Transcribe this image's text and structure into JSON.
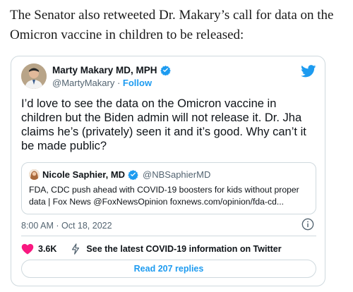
{
  "article": {
    "intro_text": "The Senator also retweeted Dr. Makary’s call for data on the Omicron vaccine in children to be released:"
  },
  "tweet": {
    "author_name": "Marty Makary MD, MPH",
    "author_handle": "@MartyMakary",
    "separator": "·",
    "follow_label": "Follow",
    "text": "I’d love to see the data on the Omicron vaccine in children but the Biden admin will not release it. Dr. Jha claims he’s (privately) seen it and it’s good. Why can’t it be made public?",
    "timestamp": "8:00 AM · Oct 18, 2022",
    "likes_count": "3.6K",
    "info_link_label": "See the latest COVID-19 information on Twitter",
    "read_replies_label": "Read 207 replies",
    "icons": {
      "brand": "twitter-bird-icon",
      "verified": "verified-badge-icon",
      "info": "info-icon",
      "like": "heart-icon",
      "info_link": "lightning-bolt-icon"
    }
  },
  "quote": {
    "author_name": "Nicole Saphier, MD",
    "author_handle": "@NBSaphierMD",
    "text": "FDA, CDC push ahead with COVID-19 boosters for kids without proper data | Fox News @FoxNewsOpinion  foxnews.com/opinion/fda-cd..."
  },
  "colors": {
    "twitter_blue": "#1d9bf0",
    "heart_red": "#f91880",
    "border": "#cfd9de",
    "secondary_text": "#536471"
  }
}
